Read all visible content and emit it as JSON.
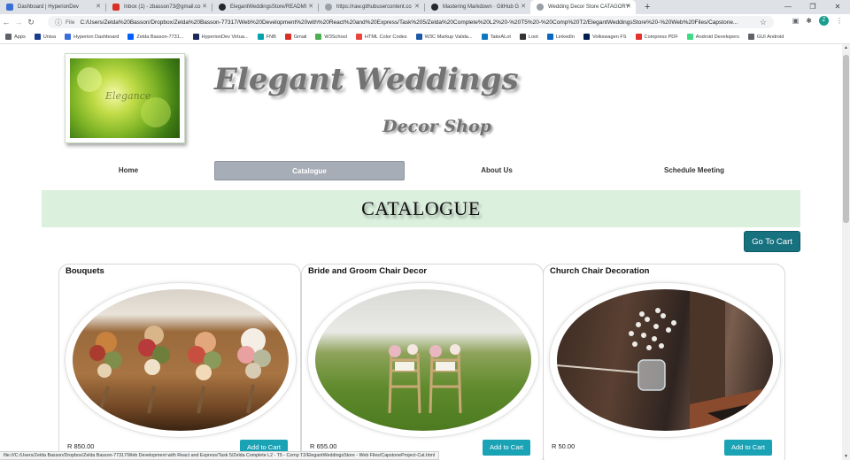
{
  "browser": {
    "tabs": [
      {
        "label": "Dashboard | HyperionDev",
        "fav": "#3b6fd8"
      },
      {
        "label": "Inbox (1) - zbasson73@gmail.co",
        "fav": "#d93025"
      },
      {
        "label": "ElegantWeddingsStore/READMI",
        "fav": "#24292e"
      },
      {
        "label": "https://raw.githubusercontent.co",
        "fav": "#5f6368"
      },
      {
        "label": "Mastering Markdown · GitHub G",
        "fav": "#24292e"
      },
      {
        "label": "Wedding Decor Store CATAGORY",
        "fav": "#5f6368"
      }
    ],
    "new_tab": "+",
    "address_prefix": "File",
    "address": "C:/Users/Zelda%20Basson/Dropbox/Zelda%20Basson-77317/Web%20Development%20with%20React%20and%20Express/Task%205/Zelda%20Complete%20L2%20-%20T5%20-%20Comp%20T2/ElegantWeddingsStore%20-%20Web%20Files/Capstone...",
    "profile_initial": "Z",
    "bookmarks": [
      {
        "label": "Apps",
        "color": "#5f6368"
      },
      {
        "label": "Unisa",
        "color": "#1a3c8c"
      },
      {
        "label": "Hyperion Dashboard",
        "color": "#3b6fd8"
      },
      {
        "label": "Zelda Basson-7731...",
        "color": "#0061fe"
      },
      {
        "label": "HyperionDev Virtua...",
        "color": "#1c2a59"
      },
      {
        "label": "FNB",
        "color": "#00a3ad"
      },
      {
        "label": "Gmail",
        "color": "#d93025"
      },
      {
        "label": "W3School",
        "color": "#4caf50"
      },
      {
        "label": "HTML Color Codes",
        "color": "#e8453c"
      },
      {
        "label": "W3C Markup Valida...",
        "color": "#1a5aa6"
      },
      {
        "label": "TakeALot",
        "color": "#0b79bf"
      },
      {
        "label": "Loot",
        "color": "#333333"
      },
      {
        "label": "LinkedIn",
        "color": "#0a66c2"
      },
      {
        "label": "Volkswagen FS",
        "color": "#001e50"
      },
      {
        "label": "Compress PDF",
        "color": "#e5322d"
      },
      {
        "label": "Android Developers",
        "color": "#3ddc84"
      },
      {
        "label": "GUI Android",
        "color": "#5f6368"
      }
    ],
    "status_url": "file:///C:/Users/Zelda Basson/Dropbox/Zelda Basson-77317/Web Development with React and Express/Task 5/Zelda Complete L2 - T5 - Comp T2/ElegantWeddingsStore - Web Files/CapstoneProject-Cat.html"
  },
  "site": {
    "logo_script": "Elegance",
    "title": "Elegant Weddings",
    "subtitle": "Decor Shop",
    "nav": [
      "Home",
      "Catalogue",
      "About Us",
      "Schedule Meeting"
    ],
    "active_nav": "Catalogue",
    "banner": "CATALOGUE",
    "cart_button": "Go To Cart",
    "products": [
      {
        "name": "Bouquets",
        "price": "R 850.00",
        "button": "Add to Cart"
      },
      {
        "name": "Bride and Groom Chair Decor",
        "price": "R 655.00",
        "button": "Add to Cart"
      },
      {
        "name": "Church Chair Decoration",
        "price": "R 50.00",
        "button": "Add to Cart"
      }
    ]
  }
}
